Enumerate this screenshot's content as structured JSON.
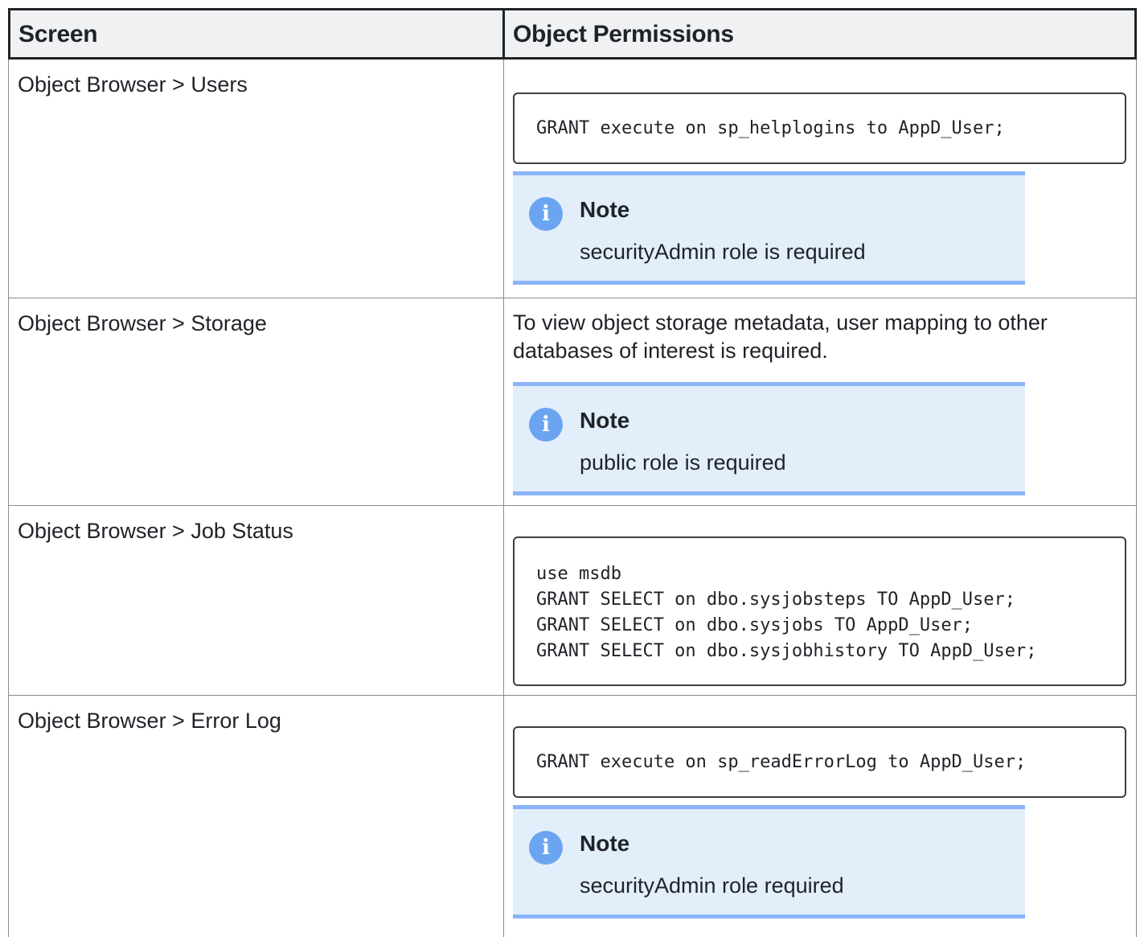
{
  "table": {
    "headers": {
      "screen": "Screen",
      "permissions": "Object Permissions"
    },
    "rows": [
      {
        "screen": "Object Browser > Users",
        "code": "GRANT execute on sp_helplogins to AppD_User;",
        "note_title": "Note",
        "note_text": "securityAdmin role is required"
      },
      {
        "screen": "Object Browser > Storage",
        "text": "To view object storage metadata, user mapping to other databases of interest is required.",
        "note_title": "Note",
        "note_text": "public role is required"
      },
      {
        "screen": "Object Browser > Job Status",
        "code": "use msdb\nGRANT SELECT on dbo.sysjobsteps TO AppD_User;\nGRANT SELECT on dbo.sysjobs TO AppD_User;\nGRANT SELECT on dbo.sysjobhistory TO AppD_User;"
      },
      {
        "screen": "Object Browser > Error Log",
        "code": "GRANT execute on sp_readErrorLog to AppD_User;",
        "note_title": "Note",
        "note_text": "securityAdmin role required"
      }
    ]
  },
  "icons": {
    "note_icon": "info-icon",
    "note_icon_glyph": "i"
  },
  "colors": {
    "note_background": "#e3eefb",
    "note_border": "#8ab4f8",
    "info_icon": "#6ba5f2",
    "header_background": "#f0f1f2"
  }
}
